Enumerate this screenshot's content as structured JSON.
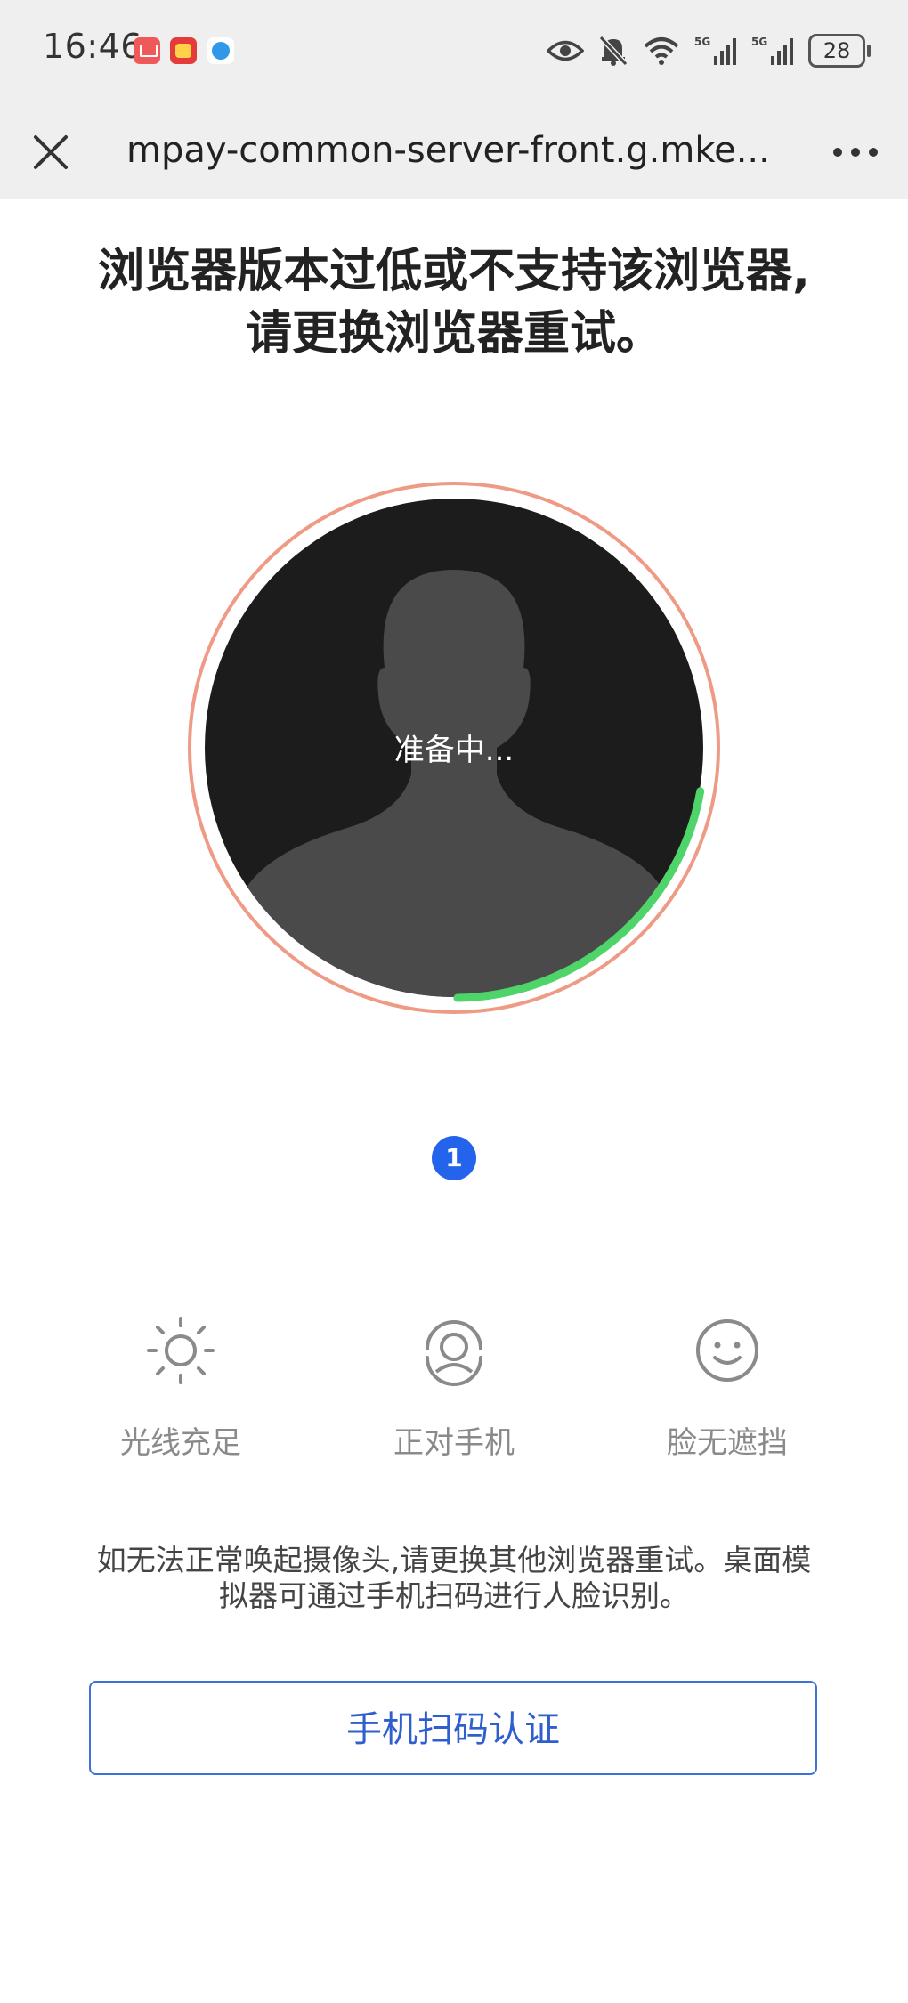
{
  "status_bar": {
    "time": "16:46",
    "battery": "28",
    "app_icons": [
      "mail-app-icon",
      "game-app-icon",
      "browser-app-icon"
    ],
    "system_icons": [
      "eye-icon",
      "mute-bell-icon",
      "wifi-icon",
      "signal-5g-icon",
      "signal-5g-icon",
      "battery-icon"
    ]
  },
  "navbar": {
    "title": "mpay-common-server-front.g.mke...",
    "close_icon": "close-icon",
    "more_icon": "more-dots-icon"
  },
  "main": {
    "heading_line1": "浏览器版本过低或不支持该浏览器,",
    "heading_line2": "请更换浏览器重试。",
    "face_status": "准备中...",
    "progress_fraction": 0.22,
    "step_number": "1",
    "tips": [
      {
        "label": "光线充足",
        "icon": "sun-icon"
      },
      {
        "label": "正对手机",
        "icon": "face-front-icon"
      },
      {
        "label": "脸无遮挡",
        "icon": "smile-icon"
      }
    ],
    "note_line1": "如无法正常唤起摄像头,请更换其他浏览器重试。桌面模",
    "note_line2": "拟器可通过手机扫码进行人脸识别。",
    "qr_button_label": "手机扫码认证"
  },
  "colors": {
    "ring_outer": "#ef9a85",
    "progress": "#4fd46a",
    "accent": "#2463eb",
    "button_text": "#2f5fcf"
  }
}
